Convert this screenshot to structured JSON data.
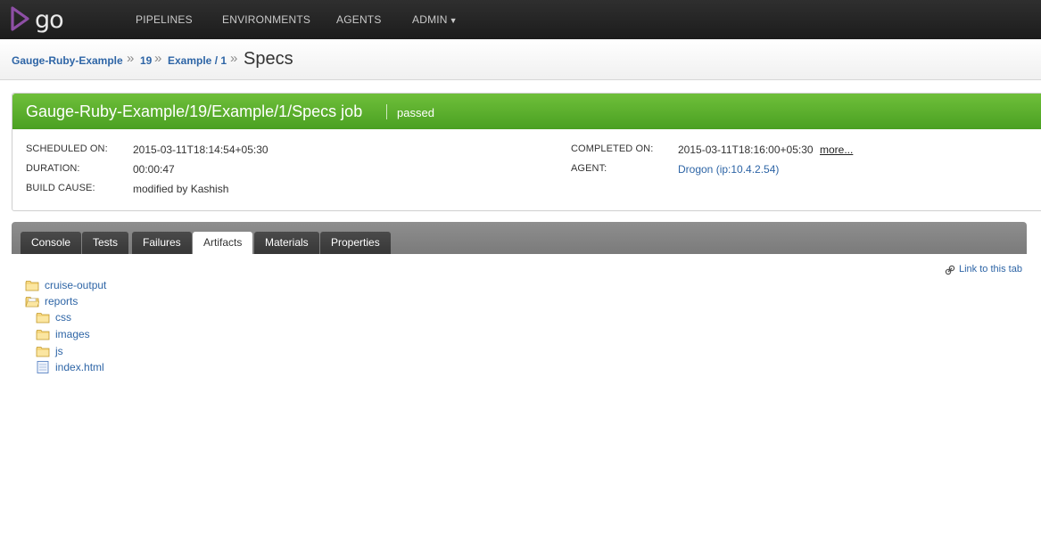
{
  "nav": {
    "logo": "go",
    "items": [
      {
        "label": "PIPELINES"
      },
      {
        "label": "ENVIRONMENTS"
      },
      {
        "label": "AGENTS"
      },
      {
        "label": "ADMIN",
        "caret": "▼"
      }
    ]
  },
  "breadcrumb": {
    "pipeline": "Gauge-Ruby-Example",
    "counter": "19",
    "stage": "Example / 1",
    "current": "Specs",
    "separator": "»"
  },
  "job": {
    "title": "Gauge-Ruby-Example/19/Example/1/Specs job",
    "status": "passed",
    "status_color": "#55a82a",
    "scheduled_label": "SCHEDULED ON:",
    "scheduled_value": "2015-03-11T18:14:54+05:30",
    "duration_label": "DURATION:",
    "duration_value": "00:00:47",
    "cause_label": "BUILD CAUSE:",
    "cause_value": "modified by Kashish",
    "completed_label": "COMPLETED ON:",
    "completed_value": "2015-03-11T18:16:00+05:30",
    "more_label": "more...",
    "agent_label": "AGENT:",
    "agent_value": "Drogon (ip:10.4.2.54)"
  },
  "tabs": [
    {
      "label": "Console"
    },
    {
      "label": "Tests"
    },
    {
      "label": "Failures"
    },
    {
      "label": "Artifacts",
      "active": true
    },
    {
      "label": "Materials"
    },
    {
      "label": "Properties"
    }
  ],
  "tab_link": {
    "label": "Link to this tab",
    "icon": "link-icon"
  },
  "artifacts": [
    {
      "name": "cruise-output",
      "type": "folder"
    },
    {
      "name": "reports",
      "type": "folder-open"
    },
    {
      "name": "css",
      "type": "folder"
    },
    {
      "name": "images",
      "type": "folder"
    },
    {
      "name": "js",
      "type": "folder"
    },
    {
      "name": "index.html",
      "type": "file"
    }
  ]
}
